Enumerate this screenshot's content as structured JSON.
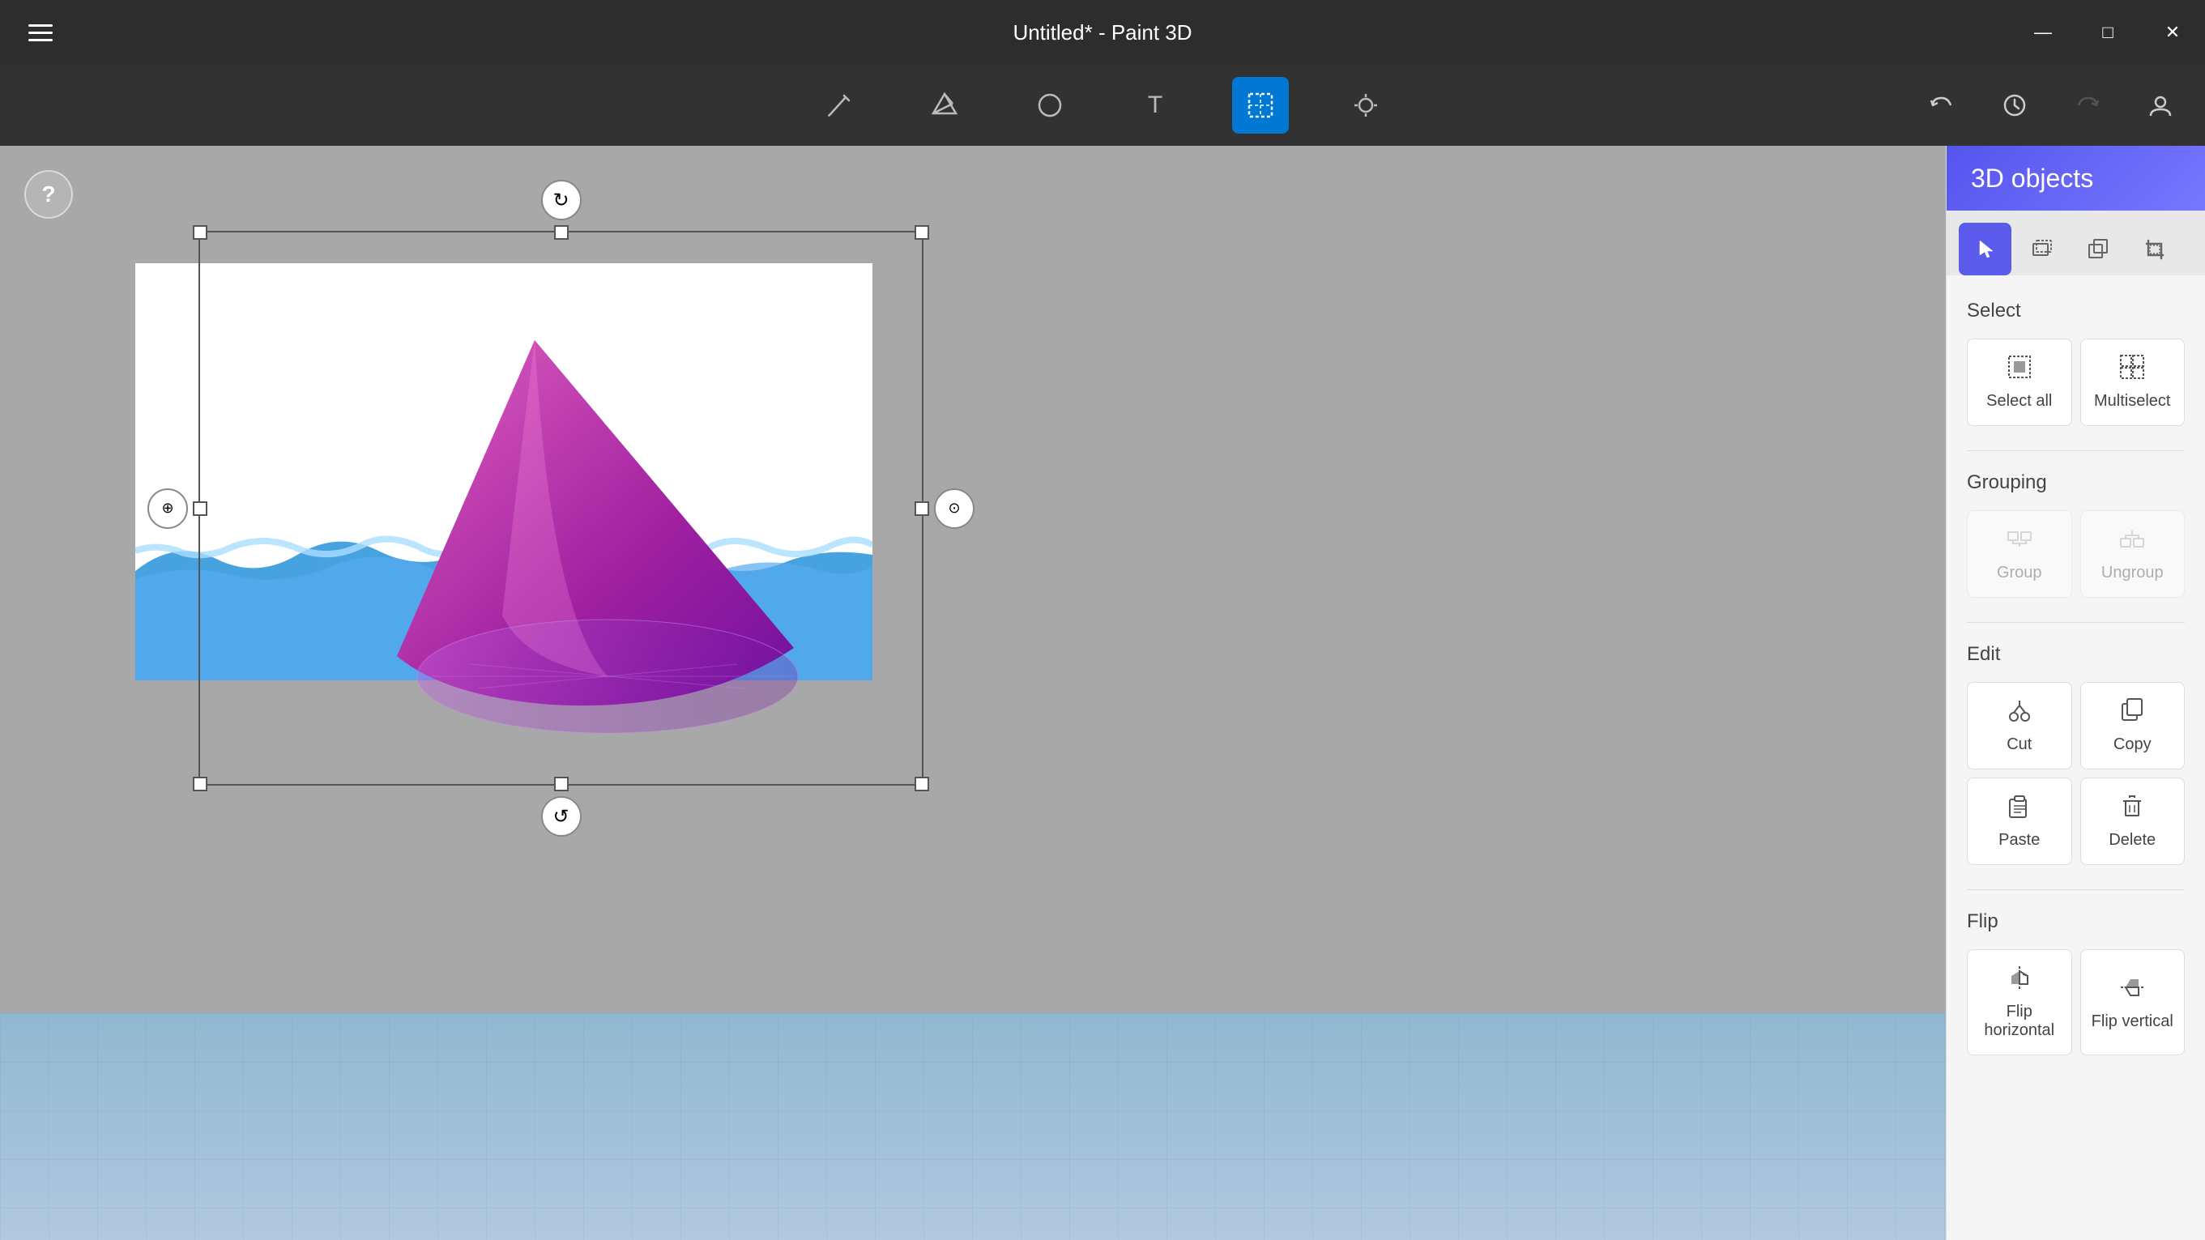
{
  "titlebar": {
    "title": "Untitled* - Paint 3D",
    "min_btn": "—",
    "max_btn": "⬜",
    "close_btn": "✕"
  },
  "toolbar": {
    "hamburger_label": "menu",
    "tools": [
      {
        "name": "brushes",
        "icon": "✏️",
        "active": false
      },
      {
        "name": "3d-shapes",
        "icon": "⬡",
        "active": false
      },
      {
        "name": "2d-shapes",
        "icon": "⬭",
        "active": false
      },
      {
        "name": "text",
        "icon": "T",
        "active": false
      },
      {
        "name": "selection",
        "icon": "⤢",
        "active": true
      },
      {
        "name": "effects",
        "icon": "✦",
        "active": false
      }
    ],
    "undo": "↩",
    "history": "🕐",
    "redo": "↪",
    "profile": "👤"
  },
  "canvas": {
    "help_label": "?"
  },
  "panel": {
    "title": "3D objects",
    "tabs": [
      {
        "name": "select",
        "icon": "cursor",
        "active": true
      },
      {
        "name": "3d-select",
        "icon": "3d-box-select",
        "active": false
      },
      {
        "name": "copy-obj",
        "icon": "duplicate",
        "active": false
      },
      {
        "name": "crop",
        "icon": "crop",
        "active": false
      }
    ],
    "select_section": {
      "label": "Select",
      "buttons": [
        {
          "name": "select-all",
          "icon": "⊡",
          "label": "Select all",
          "disabled": false
        },
        {
          "name": "multiselect",
          "icon": "⊞",
          "label": "Multiselect",
          "disabled": false
        }
      ]
    },
    "grouping_section": {
      "label": "Grouping",
      "buttons": [
        {
          "name": "group",
          "icon": "⊟",
          "label": "Group",
          "disabled": true
        },
        {
          "name": "ungroup",
          "icon": "⊠",
          "label": "Ungroup",
          "disabled": true
        }
      ]
    },
    "edit_section": {
      "label": "Edit",
      "buttons": [
        {
          "name": "cut",
          "icon": "✂",
          "label": "Cut",
          "disabled": false
        },
        {
          "name": "copy",
          "icon": "⧉",
          "label": "Copy",
          "disabled": false
        },
        {
          "name": "paste",
          "icon": "📋",
          "label": "Paste",
          "disabled": false
        },
        {
          "name": "delete",
          "icon": "🗑",
          "label": "Delete",
          "disabled": false
        }
      ]
    },
    "flip_section": {
      "label": "Flip",
      "buttons": [
        {
          "name": "flip-horizontal",
          "icon": "⇔",
          "label": "Flip horizontal",
          "disabled": false
        },
        {
          "name": "flip-vertical",
          "icon": "⇕",
          "label": "Flip vertical",
          "disabled": false
        }
      ]
    }
  }
}
